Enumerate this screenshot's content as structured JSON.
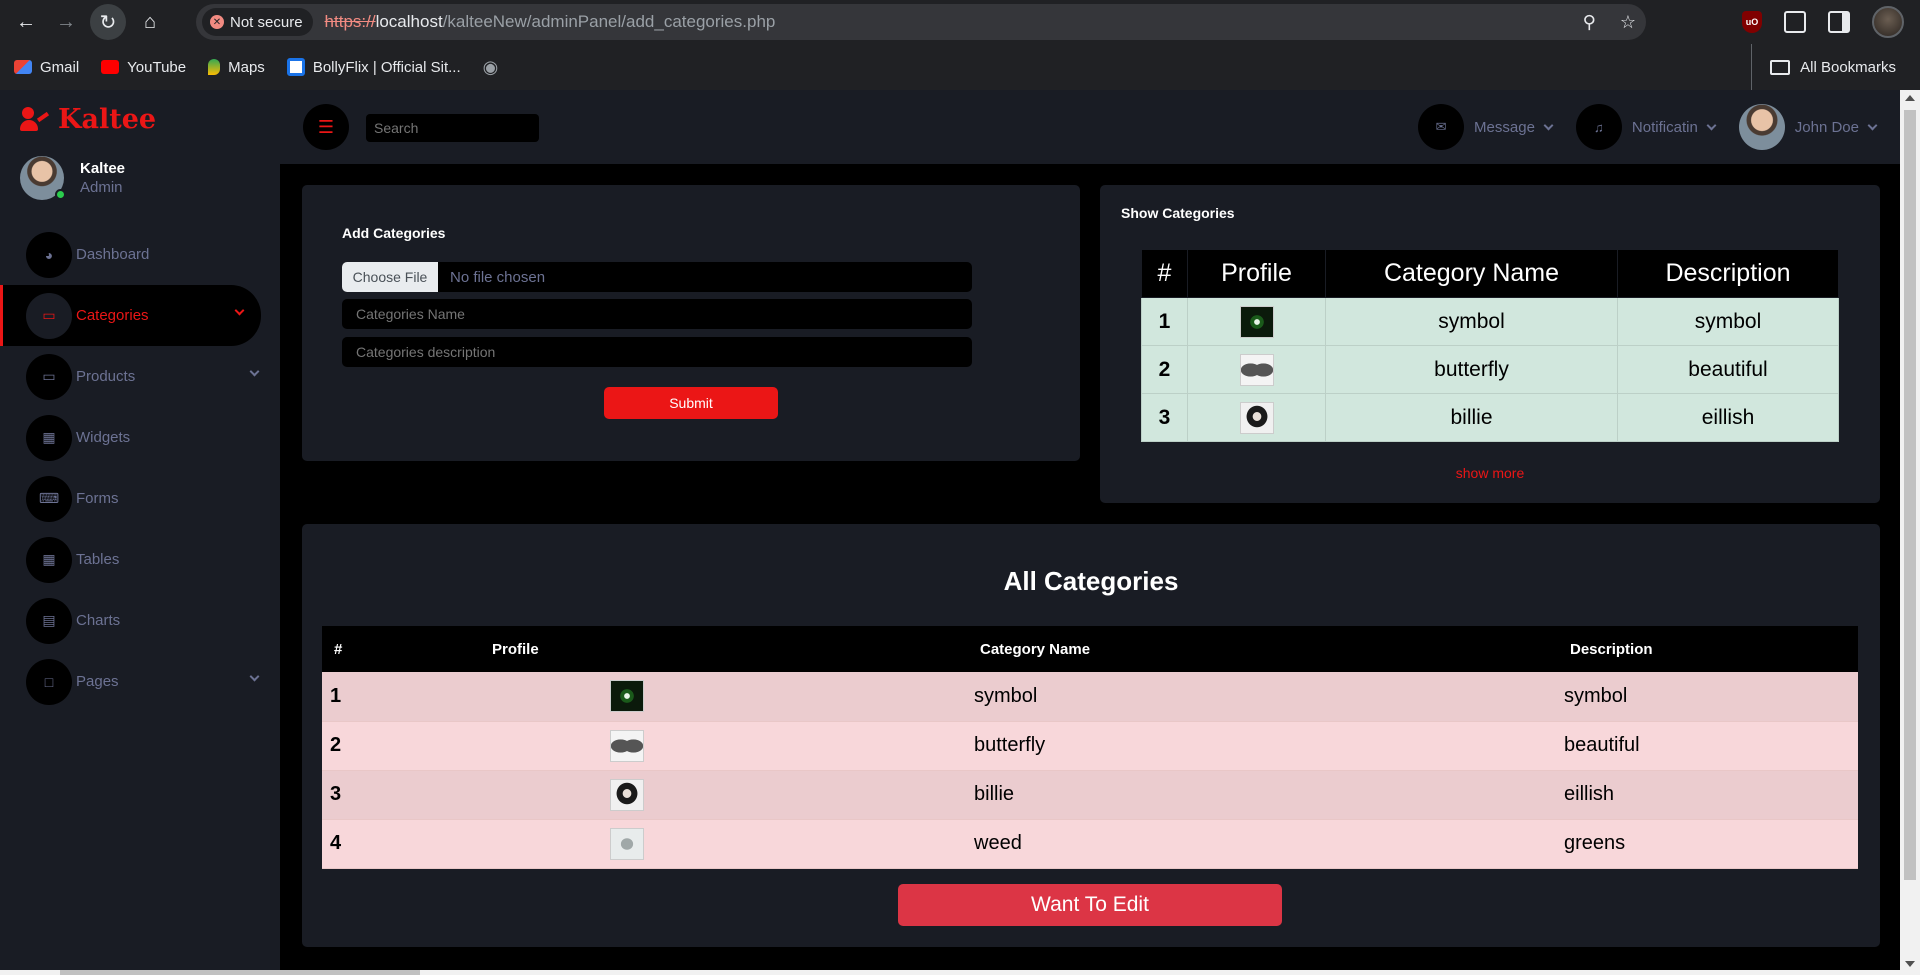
{
  "browser": {
    "security": "Not secure",
    "url_proto": "https://",
    "url_host": "localhost",
    "url_path": "/kalteeNew/adminPanel/add_categories.php",
    "bookmarks": [
      "Gmail",
      "YouTube",
      "Maps",
      "BollyFlix | Official Sit..."
    ],
    "all_bookmarks": "All Bookmarks"
  },
  "brand": "Kaltee",
  "user": {
    "name": "Kaltee",
    "role": "Admin"
  },
  "sidebar": {
    "items": [
      {
        "label": "Dashboard",
        "icon": "gauge-icon"
      },
      {
        "label": "Categories",
        "icon": "laptop-icon"
      },
      {
        "label": "Products",
        "icon": "laptop-icon"
      },
      {
        "label": "Widgets",
        "icon": "grid-icon"
      },
      {
        "label": "Forms",
        "icon": "keyboard-icon"
      },
      {
        "label": "Tables",
        "icon": "table-icon"
      },
      {
        "label": "Charts",
        "icon": "chart-icon"
      },
      {
        "label": "Pages",
        "icon": "file-icon"
      }
    ]
  },
  "topbar": {
    "search_placeholder": "Search",
    "message": "Message",
    "notification": "Notificatin",
    "profile": "John Doe"
  },
  "add_form": {
    "title": "Add Categories",
    "file_button": "Choose File",
    "file_status": "No file chosen",
    "name_placeholder": "Categories Name",
    "desc_placeholder": "Categories description",
    "submit": "Submit"
  },
  "show_panel": {
    "title": "Show Categories",
    "headers": [
      "#",
      "Profile",
      "Category Name",
      "Description"
    ],
    "rows": [
      {
        "n": "1",
        "name": "symbol",
        "desc": "symbol"
      },
      {
        "n": "2",
        "name": "butterfly",
        "desc": "beautiful"
      },
      {
        "n": "3",
        "name": "billie",
        "desc": "eillish"
      }
    ],
    "show_more": "show more"
  },
  "all_panel": {
    "title": "All Categories",
    "headers": [
      "#",
      "Profile",
      "Category Name",
      "Description"
    ],
    "rows": [
      {
        "n": "1",
        "name": "symbol",
        "desc": "symbol"
      },
      {
        "n": "2",
        "name": "butterfly",
        "desc": "beautiful"
      },
      {
        "n": "3",
        "name": "billie",
        "desc": "eillish"
      },
      {
        "n": "4",
        "name": "weed",
        "desc": "greens"
      }
    ],
    "edit_button": "Want To Edit"
  }
}
